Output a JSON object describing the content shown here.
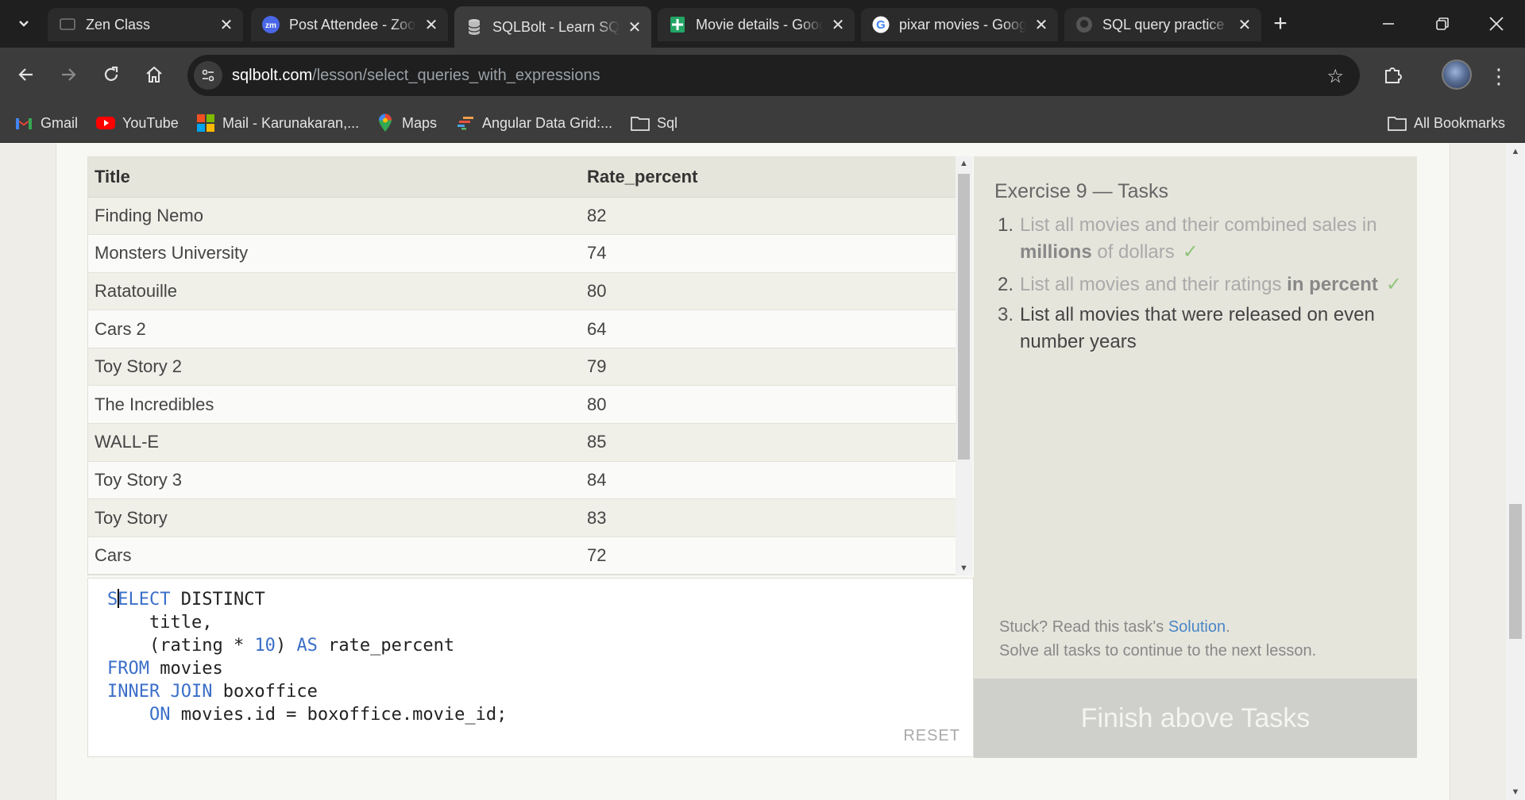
{
  "browser": {
    "tabs": [
      {
        "title": "Zen Class",
        "favicon": "zen-favicon",
        "active": false
      },
      {
        "title": "Post Attendee - Zoom",
        "favicon": "zoom-favicon",
        "active": false
      },
      {
        "title": "SQLBolt - Learn SQL",
        "favicon": "sqlbolt-favicon",
        "active": true
      },
      {
        "title": "Movie details - Google Sheets",
        "favicon": "sheets-favicon",
        "active": false
      },
      {
        "title": "pixar movies - Google Search",
        "favicon": "google-favicon",
        "active": false
      },
      {
        "title": "SQL query practice",
        "favicon": "github-favicon",
        "active": false
      }
    ],
    "new_tab_glyph": "+",
    "url_host": "sqlbolt.com",
    "url_path": "/lesson/select_queries_with_expressions",
    "bookmarks": [
      {
        "label": "Gmail",
        "icon": "gmail-icon"
      },
      {
        "label": "YouTube",
        "icon": "youtube-icon"
      },
      {
        "label": "Mail - Karunakaran,...",
        "icon": "microsoft-icon"
      },
      {
        "label": "Maps",
        "icon": "maps-icon"
      },
      {
        "label": "Angular Data Grid:...",
        "icon": "ag-grid-icon"
      },
      {
        "label": "Sql",
        "icon": "folder-icon"
      }
    ],
    "all_bookmarks": "All Bookmarks"
  },
  "results": {
    "headers": [
      "Title",
      "Rate_percent"
    ],
    "rows": [
      [
        "Finding Nemo",
        "82"
      ],
      [
        "Monsters University",
        "74"
      ],
      [
        "Ratatouille",
        "80"
      ],
      [
        "Cars 2",
        "64"
      ],
      [
        "Toy Story 2",
        "79"
      ],
      [
        "The Incredibles",
        "80"
      ],
      [
        "WALL-E",
        "85"
      ],
      [
        "Toy Story 3",
        "84"
      ],
      [
        "Toy Story",
        "83"
      ],
      [
        "Cars",
        "72"
      ]
    ]
  },
  "editor": {
    "lines": [
      [
        {
          "t": "S",
          "c": "kw"
        },
        {
          "caret": true
        },
        {
          "t": "ELECT",
          "c": "kw"
        },
        {
          "t": " DISTINCT",
          "c": ""
        }
      ],
      [
        {
          "t": "    title,",
          "c": ""
        }
      ],
      [
        {
          "t": "    (rating * ",
          "c": ""
        },
        {
          "t": "10",
          "c": "num"
        },
        {
          "t": ") ",
          "c": ""
        },
        {
          "t": "AS",
          "c": "kw"
        },
        {
          "t": " rate_percent",
          "c": ""
        }
      ],
      [
        {
          "t": "FROM",
          "c": "kw"
        },
        {
          "t": " movies",
          "c": ""
        }
      ],
      [
        {
          "t": "INNER JOIN",
          "c": "kw"
        },
        {
          "t": " boxoffice",
          "c": ""
        }
      ],
      [
        {
          "t": "    ",
          "c": ""
        },
        {
          "t": "ON",
          "c": "kw"
        },
        {
          "t": " movies.id = boxoffice.movie_id;",
          "c": ""
        }
      ]
    ],
    "reset_label": "RESET"
  },
  "exercise": {
    "title": "Exercise 9 — Tasks",
    "tasks": [
      {
        "num": "1.",
        "parts": [
          {
            "t": "List all movies and their combined sales in "
          },
          {
            "t": "millions",
            "b": true
          },
          {
            "t": " of dollars"
          }
        ],
        "done": true,
        "check": "✓"
      },
      {
        "num": "2.",
        "parts": [
          {
            "t": "List all movies and their ratings "
          },
          {
            "t": "in percent",
            "b": true
          }
        ],
        "done": true,
        "check": "✓"
      },
      {
        "num": "3.",
        "parts": [
          {
            "t": "List all movies that were released on even number years"
          }
        ],
        "done": false
      }
    ],
    "stuck_prefix": "Stuck? Read this task's ",
    "solution_link": "Solution",
    "stuck_suffix": ".",
    "continue_note": "Solve all tasks to continue to the next lesson.",
    "finish_button": "Finish above Tasks"
  }
}
